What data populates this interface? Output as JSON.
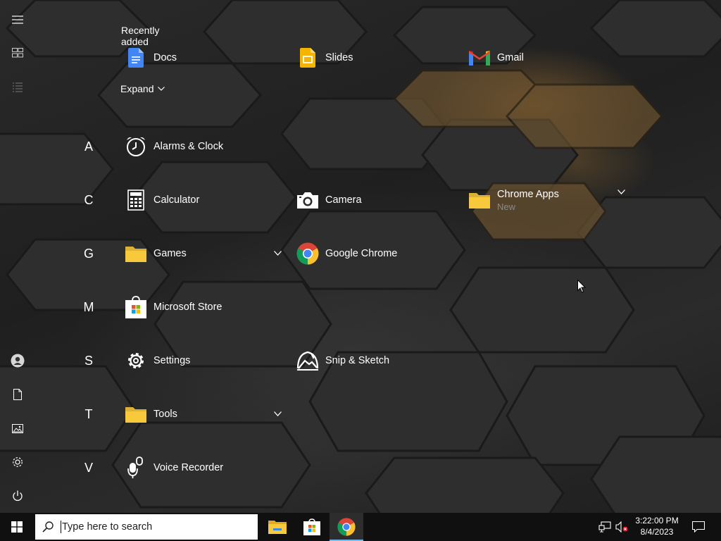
{
  "start_menu": {
    "recently_added_title": "Recently added",
    "recent": [
      {
        "label": "Docs",
        "icon": "google-docs-icon"
      },
      {
        "label": "Slides",
        "icon": "google-slides-icon"
      },
      {
        "label": "Gmail",
        "icon": "gmail-icon"
      }
    ],
    "expand_label": "Expand",
    "letters": [
      "A",
      "C",
      "G",
      "M",
      "S",
      "T",
      "V"
    ],
    "apps": {
      "alarms": "Alarms & Clock",
      "calculator": "Calculator",
      "camera": "Camera",
      "chrome_apps": "Chrome Apps",
      "chrome_apps_badge": "New",
      "games": "Games",
      "google_chrome": "Google Chrome",
      "microsoft_store": "Microsoft Store",
      "settings": "Settings",
      "snip_sketch": "Snip & Sketch",
      "tools": "Tools",
      "voice_recorder": "Voice Recorder"
    }
  },
  "taskbar": {
    "search_placeholder": "Type here to search",
    "time": "3:22:00 PM",
    "date": "8/4/2023",
    "pinned": [
      "file-explorer-icon",
      "microsoft-store-icon",
      "google-chrome-icon"
    ]
  },
  "colors": {
    "taskbar_bg": "#101010",
    "accent": "#76b9ed",
    "folder_yellow": "#f8c93a"
  }
}
